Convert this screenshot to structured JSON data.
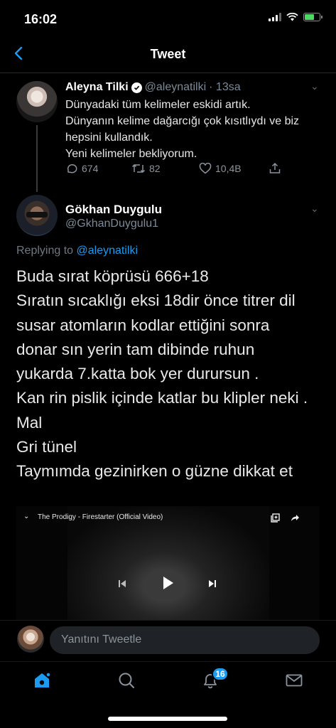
{
  "status_bar": {
    "time": "16:02"
  },
  "nav": {
    "title": "Tweet"
  },
  "parent_tweet": {
    "name": "Aleyna Tilki",
    "handle": "@aleynatilki",
    "time": "· 13sa",
    "lines": [
      "Dünyadaki tüm kelimeler eskidi artık.",
      "Dünyanın kelime dağarcığı çok kısıtlıydı ve biz",
      "hepsini kullandık.",
      "Yeni kelimeler bekliyorum."
    ],
    "replies": "674",
    "retweets": "82",
    "likes": "10,4B"
  },
  "main_tweet": {
    "name": "Gökhan Duygulu",
    "handle": "@GkhanDuygulu1",
    "replying_prefix": "Replying to",
    "replying_to": "@aleynatilki",
    "lines": [
      "Buda sırat köprüsü 666+18",
      "Sıratın sıcaklığı eksi 18dir önce titrer dil",
      "susar atomların kodlar ettiğini sonra",
      "donar sın yerin tam dibinde ruhun",
      "yukarda 7.katta bok yer durursun .",
      "Kan rin pislik içinde katlar bu klipler neki .",
      "Mal",
      "Gri tünel",
      "Taymımda gezinirken o güzne dikkat et"
    ]
  },
  "video": {
    "title": "The Prodigy - Firestarter (Official Video)"
  },
  "reply_bar": {
    "placeholder": "Yanıtını Tweetle"
  },
  "tab_bar": {
    "notifications_badge": "16"
  },
  "colors": {
    "accent": "#1d9bf0",
    "background": "#000000",
    "muted": "#7d8a96"
  }
}
